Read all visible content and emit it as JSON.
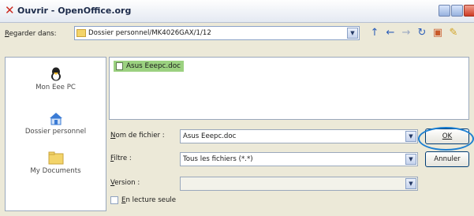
{
  "window": {
    "title": "Ouvrir - OpenOffice.org",
    "app_icon": "openoffice-icon",
    "controls": [
      "minimize-icon",
      "maximize-icon",
      "close-icon"
    ]
  },
  "toolbar": {
    "look_in_label": "Regarder dans:",
    "look_in_value": "Dossier personnel/MK4026GAX/1/12",
    "buttons": [
      "up-arrow-icon",
      "back-arrow-icon",
      "forward-arrow-icon",
      "refresh-icon",
      "new-folder-icon",
      "tools-icon"
    ]
  },
  "places": [
    {
      "label": "Mon Eee PC",
      "icon": "computer-icon"
    },
    {
      "label": "Dossier personnel",
      "icon": "home-icon"
    },
    {
      "label": "My Documents",
      "icon": "folder-icon"
    }
  ],
  "files": [
    "Asus Eeepc.doc"
  ],
  "form": {
    "filename_label": "Nom de fichier :",
    "filename_value": "Asus Eeepc.doc",
    "filter_label": "Filtre :",
    "filter_value": "Tous les fichiers (*.*)",
    "version_label": "Version :",
    "version_value": "",
    "readonly_label": "En lecture seule"
  },
  "buttons": {
    "ok": "OK",
    "cancel": "Annuler"
  },
  "colors": {
    "selection": "#9bd180",
    "highlight_ring": "#1c7fd1",
    "title": "#1d2b4a"
  }
}
